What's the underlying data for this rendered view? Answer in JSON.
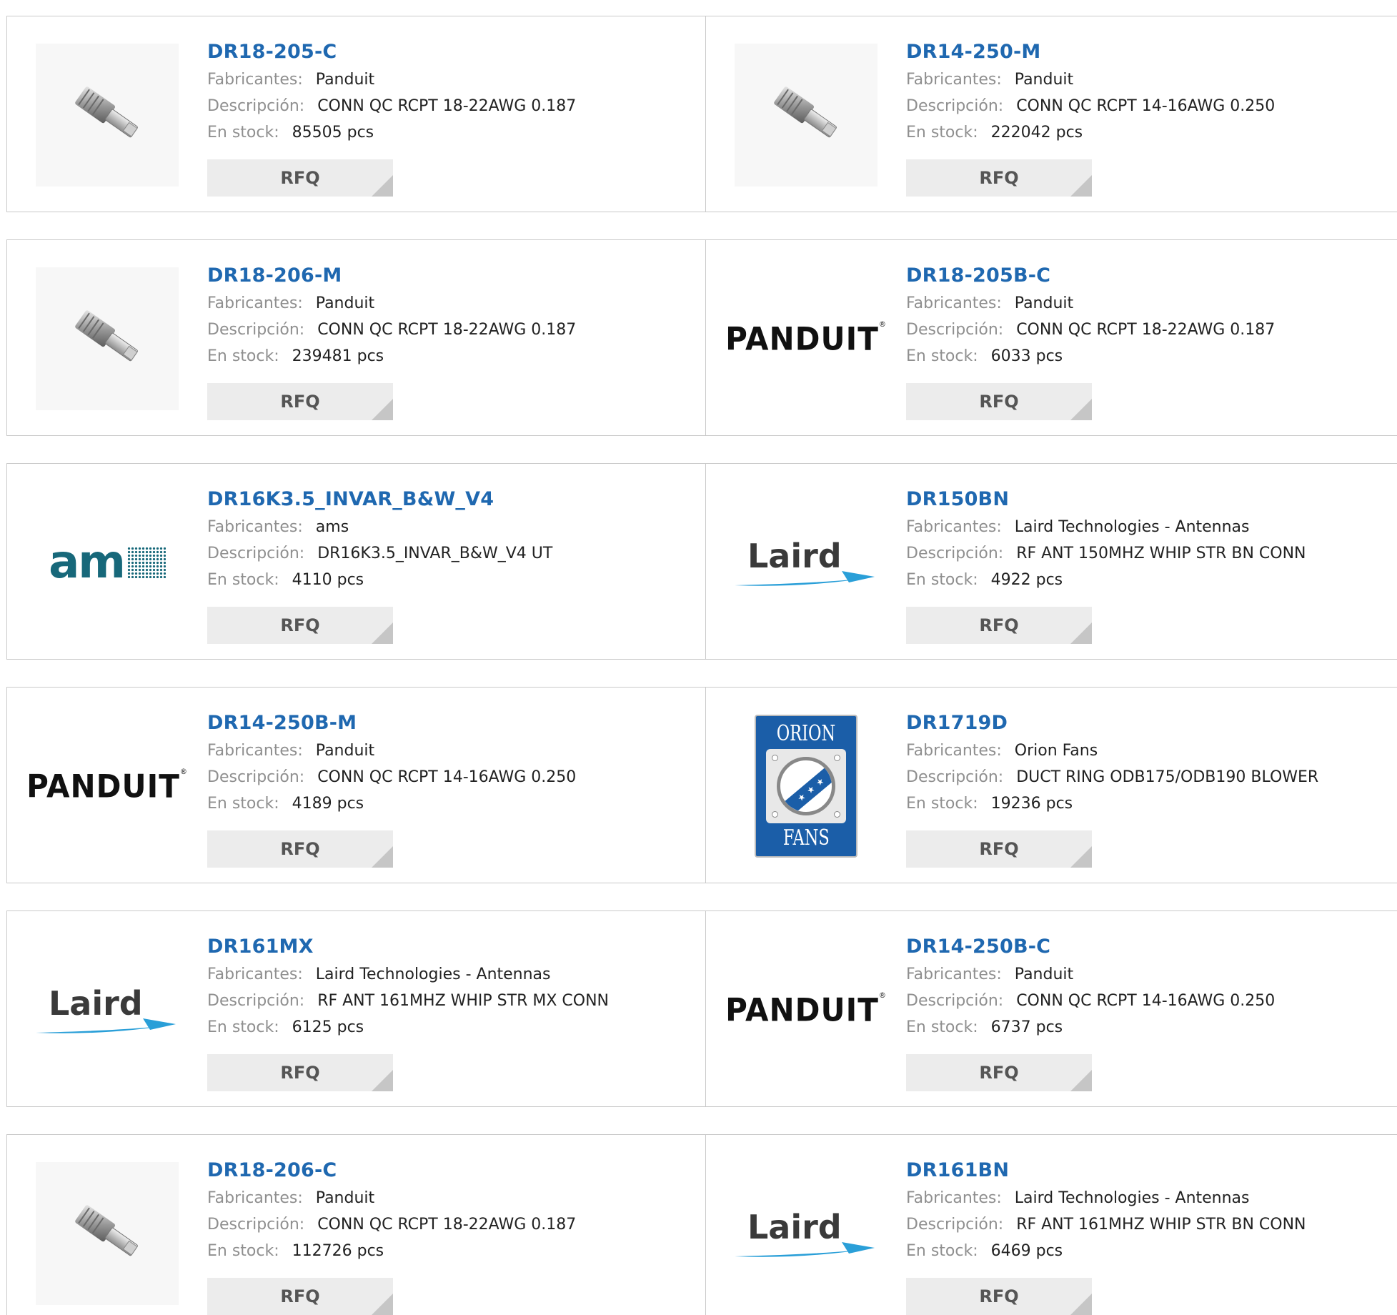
{
  "labels": {
    "manufacturer": "Fabricantes:",
    "description": "Descripción:",
    "stock": "En stock:",
    "rfq": "RFQ"
  },
  "products": [
    {
      "part": "DR18-205-C",
      "manufacturer": "Panduit",
      "description": "CONN QC RCPT 18-22AWG 0.187",
      "stock": "85505 pcs",
      "image": "connector-photo"
    },
    {
      "part": "DR14-250-M",
      "manufacturer": "Panduit",
      "description": "CONN QC RCPT 14-16AWG 0.250",
      "stock": "222042 pcs",
      "image": "connector-photo"
    },
    {
      "part": "DR18-206-M",
      "manufacturer": "Panduit",
      "description": "CONN QC RCPT 18-22AWG 0.187",
      "stock": "239481 pcs",
      "image": "connector-photo"
    },
    {
      "part": "DR18-205B-C",
      "manufacturer": "Panduit",
      "description": "CONN QC RCPT 18-22AWG 0.187",
      "stock": "6033 pcs",
      "image": "panduit-logo"
    },
    {
      "part": "DR16K3.5_INVAR_B&W_V4",
      "manufacturer": "ams",
      "description": "DR16K3.5_INVAR_B&W_V4 UT",
      "stock": "4110 pcs",
      "image": "ams-logo"
    },
    {
      "part": "DR150BN",
      "manufacturer": "Laird Technologies - Antennas",
      "description": "RF ANT 150MHZ WHIP STR BN CONN",
      "stock": "4922 pcs",
      "image": "laird-logo"
    },
    {
      "part": "DR14-250B-M",
      "manufacturer": "Panduit",
      "description": "CONN QC RCPT 14-16AWG 0.250",
      "stock": "4189 pcs",
      "image": "panduit-logo"
    },
    {
      "part": "DR1719D",
      "manufacturer": "Orion Fans",
      "description": "DUCT RING ODB175/ODB190 BLOWER",
      "stock": "19236 pcs",
      "image": "orion-fans-logo"
    },
    {
      "part": "DR161MX",
      "manufacturer": "Laird Technologies - Antennas",
      "description": "RF ANT 161MHZ WHIP STR MX CONN",
      "stock": "6125 pcs",
      "image": "laird-logo"
    },
    {
      "part": "DR14-250B-C",
      "manufacturer": "Panduit",
      "description": "CONN QC RCPT 14-16AWG 0.250",
      "stock": "6737 pcs",
      "image": "panduit-logo"
    },
    {
      "part": "DR18-206-C",
      "manufacturer": "Panduit",
      "description": "CONN QC RCPT 18-22AWG 0.187",
      "stock": "112726 pcs",
      "image": "connector-photo"
    },
    {
      "part": "DR161BN",
      "manufacturer": "Laird Technologies - Antennas",
      "description": "RF ANT 161MHZ WHIP STR BN CONN",
      "stock": "6469 pcs",
      "image": "laird-logo"
    }
  ],
  "logos": {
    "panduit": "PANDUIT",
    "ams": "am",
    "laird": "Laird",
    "orion_top": "ORION",
    "orion_bottom": "FANS"
  },
  "colors": {
    "link": "#1f68b0",
    "label": "#8f8f8f",
    "button_bg": "#ececec",
    "border": "#c9c9c9"
  }
}
